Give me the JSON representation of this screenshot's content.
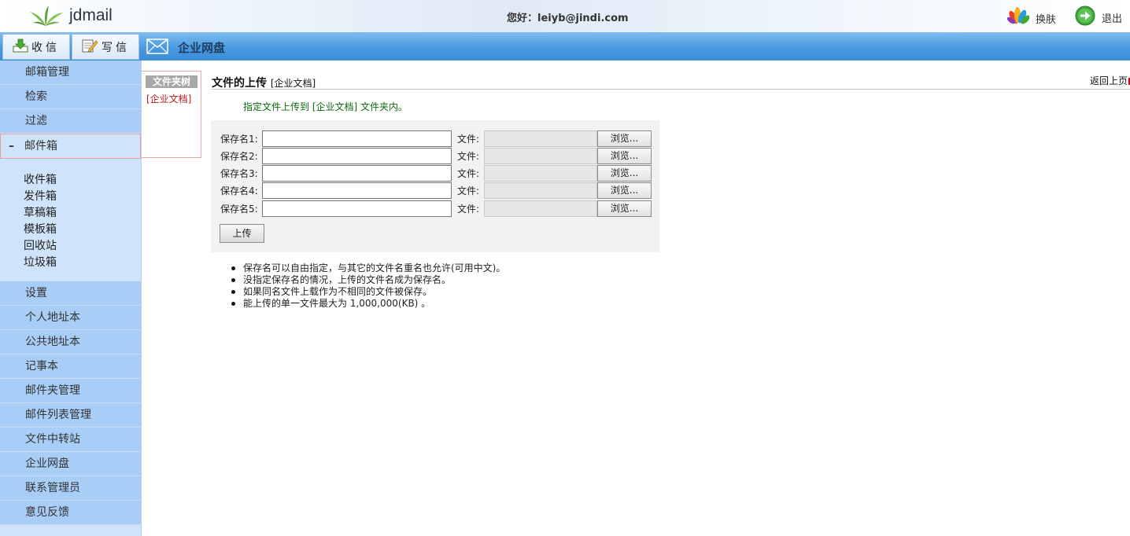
{
  "header": {
    "brand": "jdmail",
    "greeting": "您好：leiyb@jindi.com",
    "skin_label": "换肤",
    "logout_label": "退出"
  },
  "toolbar": {
    "receive_label": "收信",
    "compose_label": "写信",
    "section_title": "企业网盘"
  },
  "sidebar": {
    "top_items": [
      {
        "label": "邮箱管理"
      },
      {
        "label": "检索"
      },
      {
        "label": "过滤"
      }
    ],
    "expanded": {
      "toggle": "–",
      "label": "邮件箱"
    },
    "mailboxes": [
      {
        "label": "收件箱"
      },
      {
        "label": "发件箱"
      },
      {
        "label": "草稿箱"
      },
      {
        "label": "模板箱"
      },
      {
        "label": "回收站"
      },
      {
        "label": "垃圾箱"
      }
    ],
    "bottom_items": [
      {
        "label": "设置"
      },
      {
        "label": "个人地址本"
      },
      {
        "label": "公共地址本"
      },
      {
        "label": "记事本"
      },
      {
        "label": "邮件夹管理"
      },
      {
        "label": "邮件列表管理"
      },
      {
        "label": "文件中转站"
      },
      {
        "label": "企业网盘"
      },
      {
        "label": "联系管理员"
      },
      {
        "label": "意见反馈"
      }
    ]
  },
  "folder_tree": {
    "header": "文件夹树",
    "folder": "[企业文档]"
  },
  "main": {
    "title": "文件的上传",
    "title_sub": "[企业文档]",
    "back_link": "返回上页",
    "instruction": "指定文件上传到 [企业文档] 文件夹内。",
    "rows": [
      {
        "name_label": "保存名1:",
        "name_value": "",
        "file_label": "文件:",
        "browse_label": "浏览..."
      },
      {
        "name_label": "保存名2:",
        "name_value": "",
        "file_label": "文件:",
        "browse_label": "浏览..."
      },
      {
        "name_label": "保存名3:",
        "name_value": "",
        "file_label": "文件:",
        "browse_label": "浏览..."
      },
      {
        "name_label": "保存名4:",
        "name_value": "",
        "file_label": "文件:",
        "browse_label": "浏览..."
      },
      {
        "name_label": "保存名5:",
        "name_value": "",
        "file_label": "文件:",
        "browse_label": "浏览..."
      }
    ],
    "upload_label": "上传",
    "notes": [
      "保存名可以自由指定，与其它的文件名重名也允许(可用中文)。",
      "没指定保存名的情况，上传的文件名成为保存名。",
      "如果同名文件上载作为不相同的文件被保存。",
      "能上传的单一文件最大为 1,000,000(KB) 。"
    ]
  },
  "colors": {
    "accent_blue": "#4a9ae0",
    "sidebar_item": "#a8cef7",
    "sidebar_bg": "#cfe4fa",
    "instruction_green": "#0d6a0d",
    "folder_red": "#c01818"
  },
  "icons": {
    "logo": "bamboo-leaf-icon",
    "skin": "colorful-petal-icon",
    "logout": "green-arrow-circle-icon",
    "receive": "download-tray-icon",
    "compose": "notepad-pencil-icon",
    "section": "envelope-icon"
  }
}
